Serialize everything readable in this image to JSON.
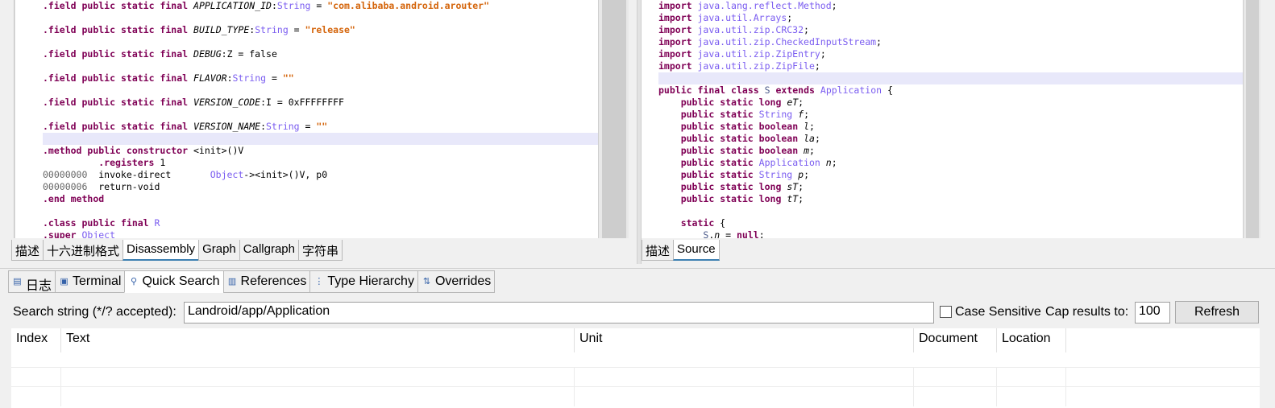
{
  "left_editor": {
    "lines": [
      {
        "html": "<span class=\"k\">.field</span> <span class=\"k\">public</span> <span class=\"k\">static</span> <span class=\"k\">final</span> <span class=\"i\">APPLICATION_ID</span>:<span class=\"t\">String</span> = <span class=\"s\">\"com.alibaba.android.arouter\"</span>",
        "hl": false
      },
      {
        "html": "",
        "hl": false
      },
      {
        "html": "<span class=\"k\">.field</span> <span class=\"k\">public</span> <span class=\"k\">static</span> <span class=\"k\">final</span> <span class=\"i\">BUILD_TYPE</span>:<span class=\"t\">String</span> = <span class=\"s\">\"release\"</span>",
        "hl": false
      },
      {
        "html": "",
        "hl": false
      },
      {
        "html": "<span class=\"k\">.field</span> <span class=\"k\">public</span> <span class=\"k\">static</span> <span class=\"k\">final</span> <span class=\"i\">DEBUG</span>:Z = false",
        "hl": false
      },
      {
        "html": "",
        "hl": false
      },
      {
        "html": "<span class=\"k\">.field</span> <span class=\"k\">public</span> <span class=\"k\">static</span> <span class=\"k\">final</span> <span class=\"i\">FLAVOR</span>:<span class=\"t\">String</span> = <span class=\"s\">\"\"</span>",
        "hl": false
      },
      {
        "html": "",
        "hl": false
      },
      {
        "html": "<span class=\"k\">.field</span> <span class=\"k\">public</span> <span class=\"k\">static</span> <span class=\"k\">final</span> <span class=\"i\">VERSION_CODE</span>:I = 0xFFFFFFFF",
        "hl": false
      },
      {
        "html": "",
        "hl": false
      },
      {
        "html": "<span class=\"k\">.field</span> <span class=\"k\">public</span> <span class=\"k\">static</span> <span class=\"k\">final</span> <span class=\"i\">VERSION_NAME</span>:<span class=\"t\">String</span> = <span class=\"s\">\"\"</span>",
        "hl": false
      },
      {
        "html": "",
        "hl": true
      },
      {
        "html": "<span class=\"k\">.method</span> <span class=\"k\">public</span> <span class=\"k\">constructor</span> &lt;init&gt;()V",
        "hl": false
      },
      {
        "html": "          <span class=\"k\">.registers</span> 1",
        "hl": false
      },
      {
        "html": "<span class=\"dim\">00000000</span>  invoke-direct       <span class=\"t\">Object</span>-&gt;&lt;init&gt;()V, p0",
        "hl": false
      },
      {
        "html": "<span class=\"dim\">00000006</span>  return-void",
        "hl": false
      },
      {
        "html": "<span class=\"k\">.end</span> <span class=\"k\">method</span>",
        "hl": false
      },
      {
        "html": "",
        "hl": false
      },
      {
        "html": "<span class=\"k\">.class</span> <span class=\"k\">public</span> <span class=\"k\">final</span> <span class=\"t\">R</span>",
        "hl": false
      },
      {
        "html": "<span class=\"k\">.super</span> <span class=\"t\">Object</span>",
        "hl": false
      }
    ],
    "tabs": [
      "描述",
      "十六进制格式",
      "Disassembly",
      "Graph",
      "Callgraph",
      "字符串"
    ],
    "active_tab": 2
  },
  "right_editor": {
    "lines": [
      {
        "html": "<span class=\"k\">import</span> <span class=\"t\">java.lang.reflect.Method</span>;",
        "hl": false
      },
      {
        "html": "<span class=\"k\">import</span> <span class=\"t\">java.util.Arrays</span>;",
        "hl": false
      },
      {
        "html": "<span class=\"k\">import</span> <span class=\"t\">java.util.zip.CRC32</span>;",
        "hl": false
      },
      {
        "html": "<span class=\"k\">import</span> <span class=\"t\">java.util.zip.CheckedInputStream</span>;",
        "hl": false
      },
      {
        "html": "<span class=\"k\">import</span> <span class=\"t\">java.util.zip.ZipEntry</span>;",
        "hl": false
      },
      {
        "html": "<span class=\"k\">import</span> <span class=\"t\">java.util.zip.ZipFile</span>;",
        "hl": false
      },
      {
        "html": "",
        "hl": true
      },
      {
        "html": "<span class=\"k\">public</span> <span class=\"k\">final</span> <span class=\"k\">class</span> <span class=\"o\">S</span> <span class=\"k\">extends</span> <span class=\"t\">Application</span> {",
        "hl": false
      },
      {
        "html": "    <span class=\"k\">public</span> <span class=\"k\">static</span> <span class=\"k\">long</span> <span class=\"i\">eT</span>;",
        "hl": false
      },
      {
        "html": "    <span class=\"k\">public</span> <span class=\"k\">static</span> <span class=\"t\">String</span> <span class=\"i\">f</span>;",
        "hl": false
      },
      {
        "html": "    <span class=\"k\">public</span> <span class=\"k\">static</span> <span class=\"k\">boolean</span> <span class=\"i\">l</span>;",
        "hl": false
      },
      {
        "html": "    <span class=\"k\">public</span> <span class=\"k\">static</span> <span class=\"k\">boolean</span> <span class=\"i\">la</span>;",
        "hl": false
      },
      {
        "html": "    <span class=\"k\">public</span> <span class=\"k\">static</span> <span class=\"k\">boolean</span> <span class=\"i\">m</span>;",
        "hl": false
      },
      {
        "html": "    <span class=\"k\">public</span> <span class=\"k\">static</span> <span class=\"t\">Application</span> <span class=\"i\">n</span>;",
        "hl": false
      },
      {
        "html": "    <span class=\"k\">public</span> <span class=\"k\">static</span> <span class=\"t\">String</span> <span class=\"i\">p</span>;",
        "hl": false
      },
      {
        "html": "    <span class=\"k\">public</span> <span class=\"k\">static</span> <span class=\"k\">long</span> <span class=\"i\">sT</span>;",
        "hl": false
      },
      {
        "html": "    <span class=\"k\">public</span> <span class=\"k\">static</span> <span class=\"k\">long</span> <span class=\"i\">tT</span>;",
        "hl": false
      },
      {
        "html": "",
        "hl": false
      },
      {
        "html": "    <span class=\"k\">static</span> {",
        "hl": false
      },
      {
        "html": "        <span class=\"o\">S</span>.<span class=\"i\">n</span> = <span class=\"k\">null</span>;",
        "hl": false
      }
    ],
    "tabs": [
      "描述",
      "Source"
    ],
    "active_tab": 1
  },
  "bottom_panel": {
    "tabs": [
      {
        "label": "日志",
        "icon": "log-icon"
      },
      {
        "label": "Terminal",
        "icon": "terminal-icon"
      },
      {
        "label": "Quick Search",
        "icon": "search-icon"
      },
      {
        "label": "References",
        "icon": "references-icon"
      },
      {
        "label": "Type Hierarchy",
        "icon": "hierarchy-icon"
      },
      {
        "label": "Overrides",
        "icon": "overrides-icon"
      }
    ],
    "active_tab": 2,
    "search_label": "Search string (*/? accepted):",
    "search_value": "Landroid/app/Application",
    "case_sensitive_label": "Case Sensitive",
    "case_sensitive_checked": false,
    "cap_label": "Cap results to:",
    "cap_value": "100",
    "refresh_label": "Refresh",
    "columns": [
      "Index",
      "Text",
      "Unit",
      "Document",
      "Location"
    ]
  }
}
